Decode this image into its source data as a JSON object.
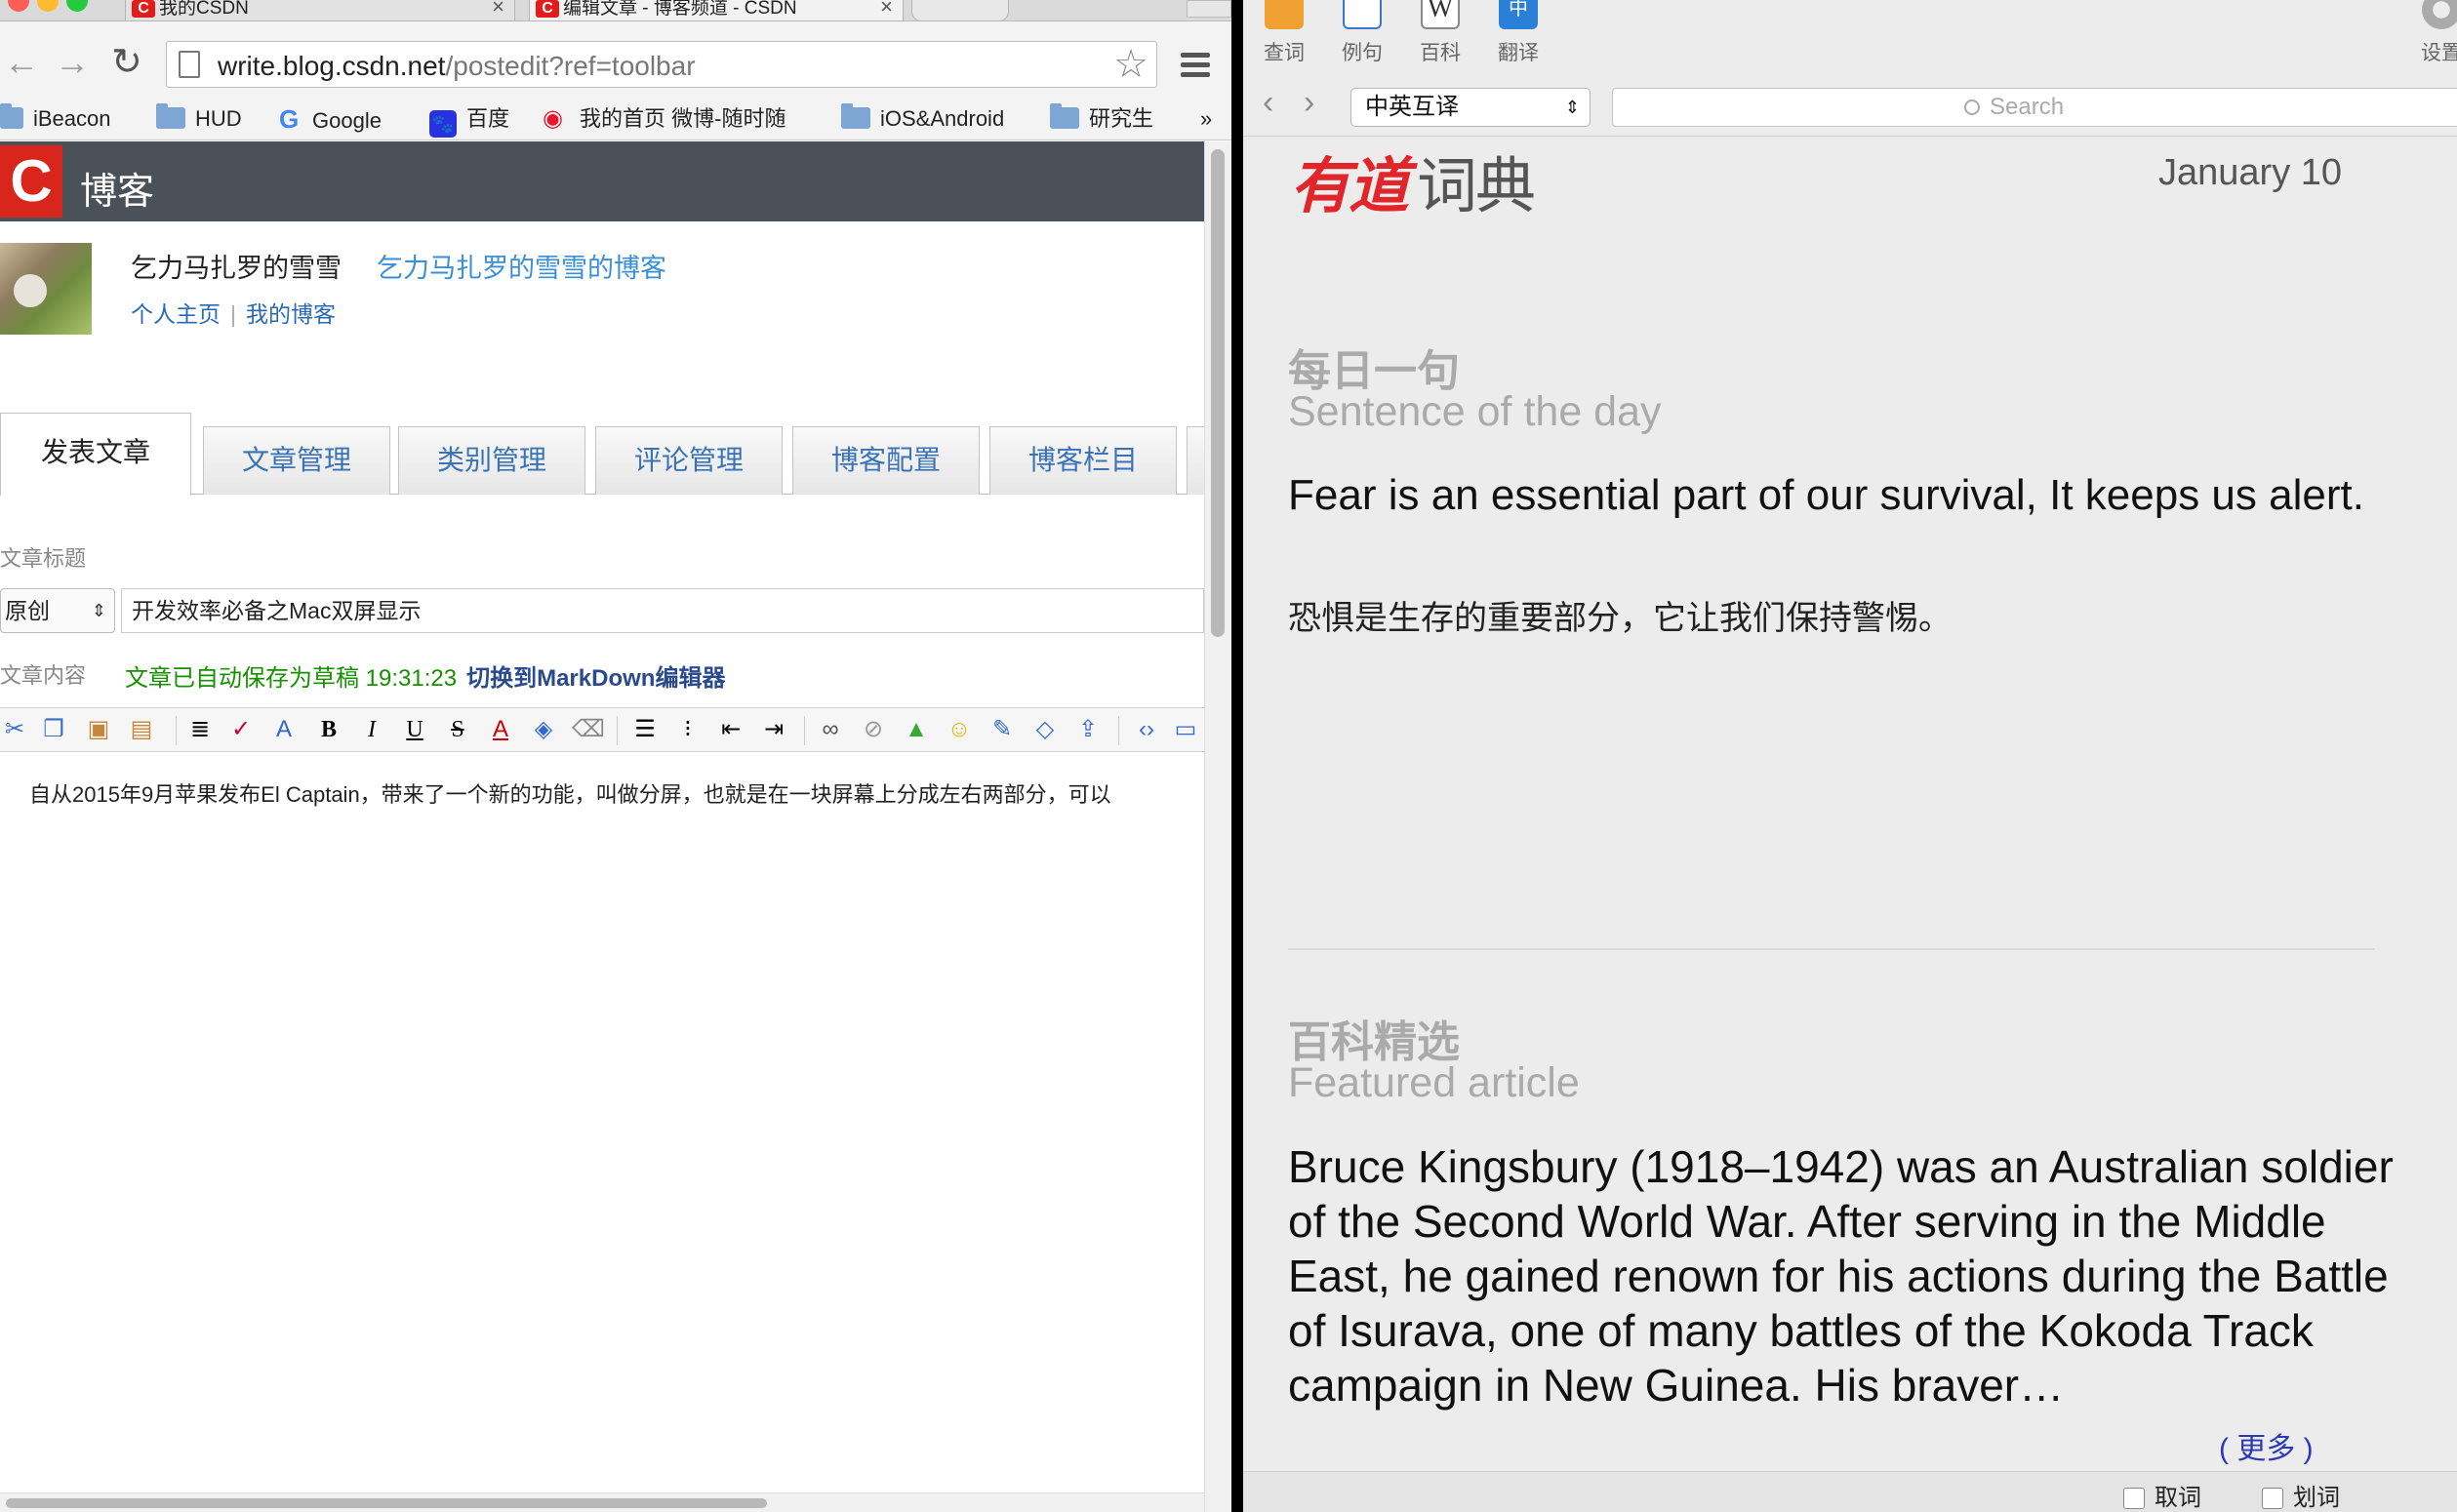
{
  "browser": {
    "tabs": [
      {
        "title": "我的CSDN"
      },
      {
        "title": "编辑文章 - 博客频道 - CSDN"
      }
    ],
    "url_host": "write.blog.csdn.net",
    "url_path": "/postedit?ref=toolbar",
    "bookmarks": [
      "iBeacon",
      "HUD",
      "Google",
      "百度",
      "我的首页 微博-随时随",
      "iOS&Android",
      "研究生",
      "»"
    ]
  },
  "csdn": {
    "logo": "C",
    "title": "博客",
    "author": "乞力马扎罗的雪雪",
    "blog_name": "乞力马扎罗的雪雪的博客",
    "link_home": "个人主页",
    "link_sep": "|",
    "link_blog": "我的博客",
    "tabs": [
      "发表文章",
      "文章管理",
      "类别管理",
      "评论管理",
      "博客配置",
      "博客栏目"
    ],
    "label_title": "文章标题",
    "article_type": "原创",
    "article_title": "开发效率必备之Mac双屏显示",
    "label_content": "文章内容",
    "autosave": "文章已自动保存为草稿 19:31:23",
    "markdown_link": "切换到MarkDown编辑器",
    "body_text": "自从2015年9月苹果发布El Captain，带来了一个新的功能，叫做分屏，也就是在一块屏幕上分成左右两部分，可以"
  },
  "dict": {
    "tools": [
      "查词",
      "例句",
      "百科",
      "翻译",
      "设置"
    ],
    "lang": "中英互译",
    "search_placeholder": "Search",
    "logo_main": "有道",
    "logo_sub": "词典",
    "date": "January 10",
    "daily_cn": "每日一句",
    "daily_en": "Sentence of the day",
    "sentence_en": "Fear is an essential part of our survival, It keeps us alert.",
    "sentence_cn": "恐惧是生存的重要部分，它让我们保持警惕。",
    "featured_cn": "百科精选",
    "featured_en": "Featured article",
    "article": "Bruce Kingsbury (1918–1942) was an Australian soldier of the Second World War. After serving in the Middle East, he gained renown for his actions during the Battle of Isurava, one of many battles of the Kokoda Track campaign in New Guinea. His braver…",
    "more": "( 更多 )",
    "check_pick": "取词",
    "check_select": "划词"
  }
}
